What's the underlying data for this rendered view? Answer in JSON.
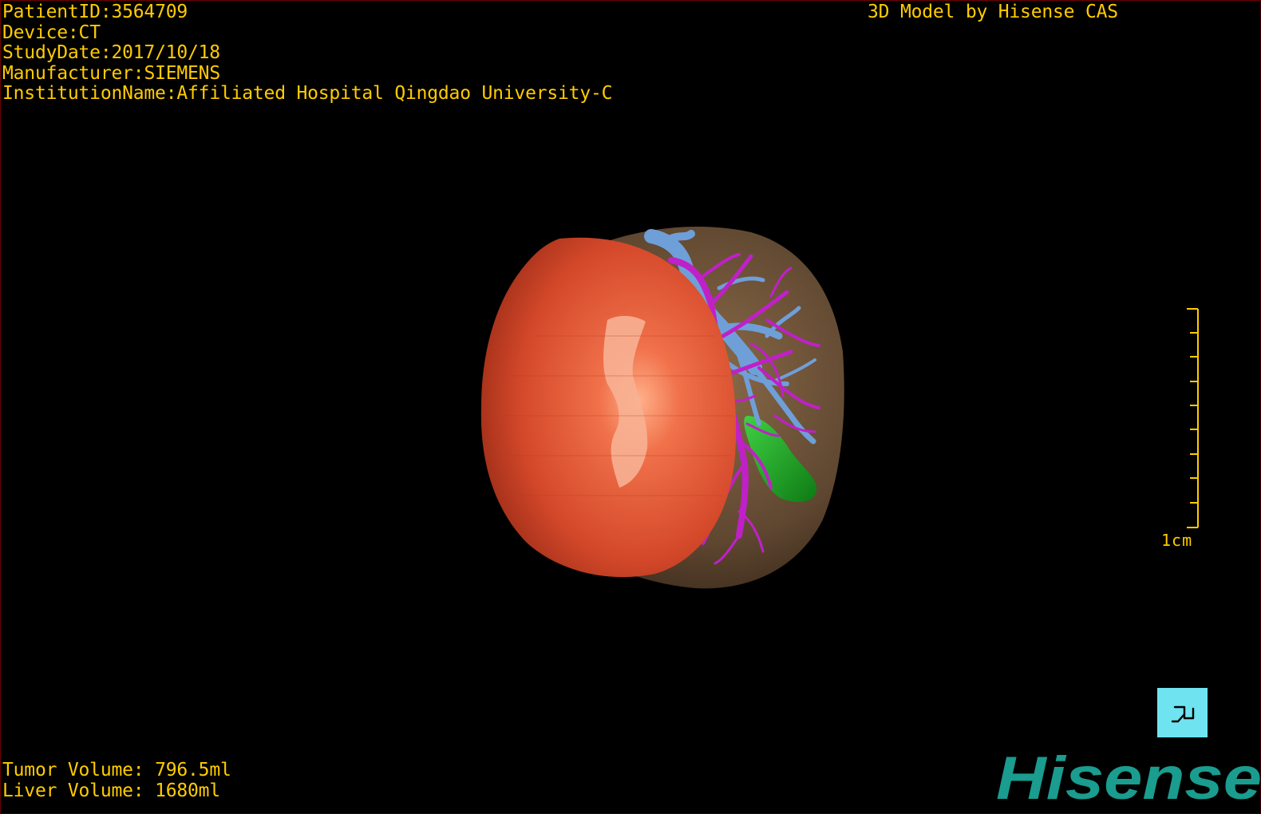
{
  "patient_info": {
    "patient_id_label": "PatientID",
    "patient_id": "3564709",
    "device_label": "Device",
    "device": "CT",
    "study_date_label": "StudyDate",
    "study_date": "2017/10/18",
    "manufacturer_label": "Manufacturer",
    "manufacturer": "SIEMENS",
    "institution_label": "InstitutionName",
    "institution": "Affiliated Hospital Qingdao University-C"
  },
  "credit": "3D Model by Hisense CAS",
  "volumes": {
    "tumor_label": "Tumor Volume",
    "tumor_value": "796.5ml",
    "liver_label": "Liver Volume",
    "liver_value": "1680ml"
  },
  "scale_bar": {
    "label": "1cm"
  },
  "orientation_button": {
    "icon": "orientation-cube-icon"
  },
  "logo": {
    "text": "Hisense",
    "color": "#1a9c8f"
  },
  "colors": {
    "overlay_text": "#ffcc00",
    "tumor": "#e5532f",
    "liver": "#6b5238",
    "portal_vein": "#6f9fd8",
    "hepatic_vessels": "#c020c8",
    "gallbladder": "#22a62a",
    "orient_button_bg": "#6fe3f0"
  }
}
